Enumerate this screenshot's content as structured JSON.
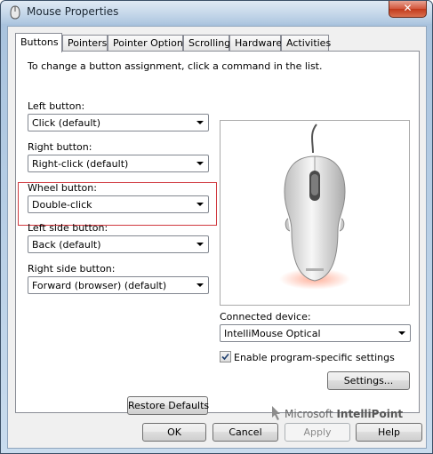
{
  "window": {
    "title": "Mouse Properties",
    "close_label": "✕",
    "accent_color": "#d0393f"
  },
  "tabs": [
    {
      "label": "Buttons",
      "active": true
    },
    {
      "label": "Pointers"
    },
    {
      "label": "Pointer Options"
    },
    {
      "label": "Scrolling"
    },
    {
      "label": "Hardware"
    },
    {
      "label": "Activities"
    }
  ],
  "panel": {
    "instruction": "To change a button assignment, click a command in the list.",
    "left_button": {
      "label": "Left button:",
      "value": "Click (default)"
    },
    "right_button": {
      "label": "Right button:",
      "value": "Right-click (default)"
    },
    "wheel_button": {
      "label": "Wheel button:",
      "value": "Double-click"
    },
    "left_side_button": {
      "label": "Left side button:",
      "value": "Back (default)"
    },
    "right_side_button": {
      "label": "Right side button:",
      "value": "Forward (browser) (default)"
    },
    "connected_device": {
      "label": "Connected device:",
      "value": "IntelliMouse Optical"
    },
    "program_specific": {
      "label": "Enable program-specific settings",
      "checked": true
    },
    "settings_button": "Settings...",
    "restore_button": "Restore Defaults",
    "brand": {
      "part1": "Microsoft",
      "part2": "IntelliPoint"
    }
  },
  "footer": {
    "ok": "OK",
    "cancel": "Cancel",
    "apply": "Apply",
    "help": "Help"
  }
}
